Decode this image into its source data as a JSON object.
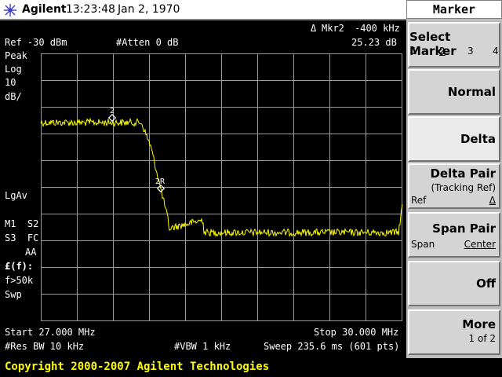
{
  "header": {
    "brand": "Agilent",
    "time": "13:23:48",
    "date": "Jan 2, 1970"
  },
  "marker_readout": {
    "label": "Mkr2",
    "freq": "-400 kHz",
    "amp": "25.23 dB",
    "delta_symbol": "Δ"
  },
  "settings": {
    "ref": "Ref -30 dBm",
    "atten": "#Atten 0 dB",
    "mode": "Peak",
    "scale_type": "Log",
    "scale_value": "10",
    "scale_unit": "dB/",
    "avg": "LgAv",
    "m1s2": "M1  S2",
    "s3fc": "S3  FC",
    "aa": "AA",
    "ff": "£(f):",
    "f50k": "f>50k",
    "swp": "Swp"
  },
  "footer_info": {
    "start": "Start 27.000 MHz",
    "stop": "Stop 30.000 MHz",
    "rbw": "#Res BW 10 kHz",
    "vbw": "#VBW 1 kHz",
    "sweep": "Sweep 235.6 ms (601 pts)"
  },
  "markers": {
    "m2": "2",
    "m2r": "2R"
  },
  "softkeys": {
    "title": "Marker",
    "select_marker": {
      "label": "Select Marker",
      "options": [
        "1",
        "2",
        "3",
        "4"
      ],
      "selected": "2"
    },
    "normal": "Normal",
    "delta": "Delta",
    "delta_pair": {
      "label": "Delta Pair",
      "sub": "(Tracking Ref)",
      "left": "Ref",
      "right": "Δ"
    },
    "span_pair": {
      "label": "Span Pair",
      "left": "Span",
      "right": "Center"
    },
    "off": "Off",
    "more": {
      "label": "More",
      "sub": "1 of 2"
    }
  },
  "copyright": "Copyright 2000-2007 Agilent Technologies",
  "colors": {
    "trace": "#ffff00",
    "grid": "#9a9a9a",
    "background": "#000000"
  }
}
